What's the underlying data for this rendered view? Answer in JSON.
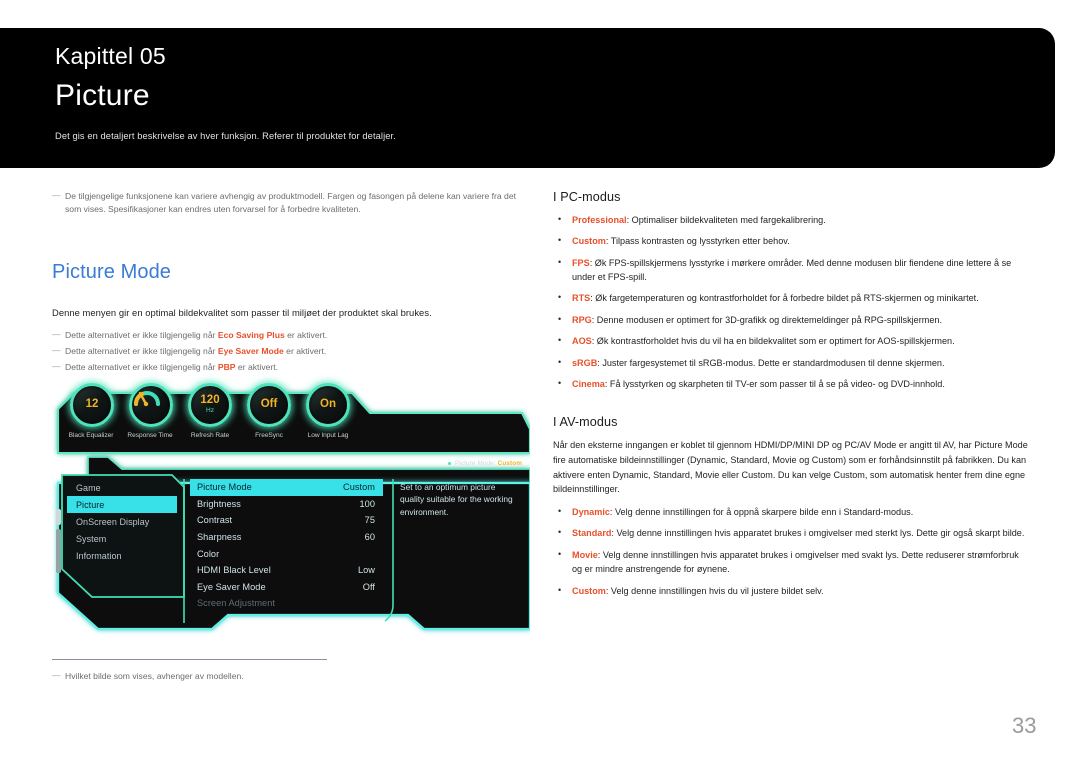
{
  "header": {
    "chapter": "Kapittel 05",
    "title": "Picture",
    "subtitle": "Det gis en detaljert beskrivelse av hver funksjon. Referer til produktet for detaljer."
  },
  "left": {
    "intro_note": "De tilgjengelige funksjonene kan variere avhengig av produktmodell. Fargen og fasongen på delene kan variere fra det som vises. Spesifikasjoner kan endres uten forvarsel for å forbedre kvaliteten.",
    "section_title": "Picture Mode",
    "lead": "Denne menyen gir en optimal bildekvalitet som passer til miljøet der produktet skal brukes.",
    "notes": [
      {
        "pre": "Dette alternativet er ikke tilgjengelig når ",
        "term": "Eco Saving Plus",
        "post": " er aktivert."
      },
      {
        "pre": "Dette alternativet er ikke tilgjengelig når ",
        "term": "Eye Saver Mode",
        "post": " er aktivert."
      },
      {
        "pre": "Dette alternativet er ikke tilgjengelig når ",
        "term": "PBP",
        "post": " er aktivert."
      }
    ],
    "footnote": "Hvilket bilde som vises, avhenger av modellen."
  },
  "osd": {
    "knobs": [
      {
        "value": "12",
        "unit": "",
        "label": "Black Equalizer",
        "type": "value"
      },
      {
        "value": "",
        "unit": "",
        "label": "Response Time",
        "type": "gauge"
      },
      {
        "value": "120",
        "unit": "Hz",
        "label": "Refresh Rate",
        "type": "value"
      },
      {
        "value": "Off",
        "unit": "",
        "label": "FreeSync",
        "type": "value"
      },
      {
        "value": "On",
        "unit": "",
        "label": "Low Input Lag",
        "type": "value"
      }
    ],
    "status_label": "Picture Mode:",
    "status_value": "Custom",
    "left_menu": [
      {
        "label": "Game",
        "selected": false
      },
      {
        "label": "Picture",
        "selected": true
      },
      {
        "label": "OnScreen Display",
        "selected": false
      },
      {
        "label": "System",
        "selected": false
      },
      {
        "label": "Information",
        "selected": false
      }
    ],
    "settings": [
      {
        "label": "Picture Mode",
        "value": "Custom",
        "selected": true,
        "dim": false
      },
      {
        "label": "Brightness",
        "value": "100",
        "selected": false,
        "dim": false
      },
      {
        "label": "Contrast",
        "value": "75",
        "selected": false,
        "dim": false
      },
      {
        "label": "Sharpness",
        "value": "60",
        "selected": false,
        "dim": false
      },
      {
        "label": "Color",
        "value": "",
        "selected": false,
        "dim": false
      },
      {
        "label": "HDMI Black Level",
        "value": "Low",
        "selected": false,
        "dim": false
      },
      {
        "label": "Eye Saver Mode",
        "value": "Off",
        "selected": false,
        "dim": false
      },
      {
        "label": "Screen Adjustment",
        "value": "",
        "selected": false,
        "dim": true
      }
    ],
    "description": "Set to an optimum picture quality suitable for the working environment.",
    "colors": {
      "accent_cyan": "#4fe3bb",
      "select_cyan": "#38e0e8",
      "amber": "#f0b429",
      "panel_black": "#0a0d0e"
    }
  },
  "right": {
    "pc_heading": "I PC-modus",
    "pc_items": [
      {
        "term": "Professional",
        "text": ": Optimaliser bildekvaliteten med fargekalibrering."
      },
      {
        "term": "Custom",
        "text": ": Tilpass kontrasten og lysstyrken etter behov."
      },
      {
        "term": "FPS",
        "text": ": Øk FPS-spillskjermens lysstyrke i mørkere områder. Med denne modusen blir fiendene dine lettere å se under et FPS-spill."
      },
      {
        "term": "RTS",
        "text": ": Øk fargetemperaturen og kontrastforholdet for å forbedre bildet på RTS-skjermen og minikartet."
      },
      {
        "term": "RPG",
        "text": ": Denne modusen er optimert for 3D-grafikk og direktemeldinger på RPG-spillskjermen."
      },
      {
        "term": "AOS",
        "text": ": Øk kontrastforholdet hvis du vil ha en bildekvalitet som er optimert for AOS-spillskjermen."
      },
      {
        "term": "sRGB",
        "text": ": Juster fargesystemet til sRGB-modus. Dette er standardmodusen til denne skjermen."
      },
      {
        "term": "Cinema",
        "text": ": Få lysstyrken og skarpheten til TV-er som passer til å se på video- og DVD-innhold."
      }
    ],
    "av_heading": "I AV-modus",
    "av_paragraph": "Når den eksterne inngangen er koblet til gjennom HDMI/DP/MINI DP og PC/AV Mode er angitt til AV, har Picture Mode fire automatiske bildeinnstillinger (Dynamic, Standard, Movie og Custom) som er forhåndsinnstilt på fabrikken. Du kan aktivere enten Dynamic, Standard, Movie eller Custom. Du kan velge Custom, som automatisk henter frem dine egne bildeinnstillinger.",
    "av_items": [
      {
        "term": "Dynamic",
        "text": ": Velg denne innstillingen for å oppnå skarpere bilde enn i Standard-modus."
      },
      {
        "term": "Standard",
        "text": ": Velg denne innstillingen hvis apparatet brukes i omgivelser med sterkt lys. Dette gir også skarpt bilde."
      },
      {
        "term": "Movie",
        "text": ": Velg denne innstillingen hvis apparatet brukes i omgivelser med svakt lys. Dette reduserer strømforbruk og er mindre anstrengende for øynene."
      },
      {
        "term": "Custom",
        "text": ": Velg denne innstillingen hvis du vil justere bildet selv."
      }
    ]
  },
  "page_number": "33"
}
